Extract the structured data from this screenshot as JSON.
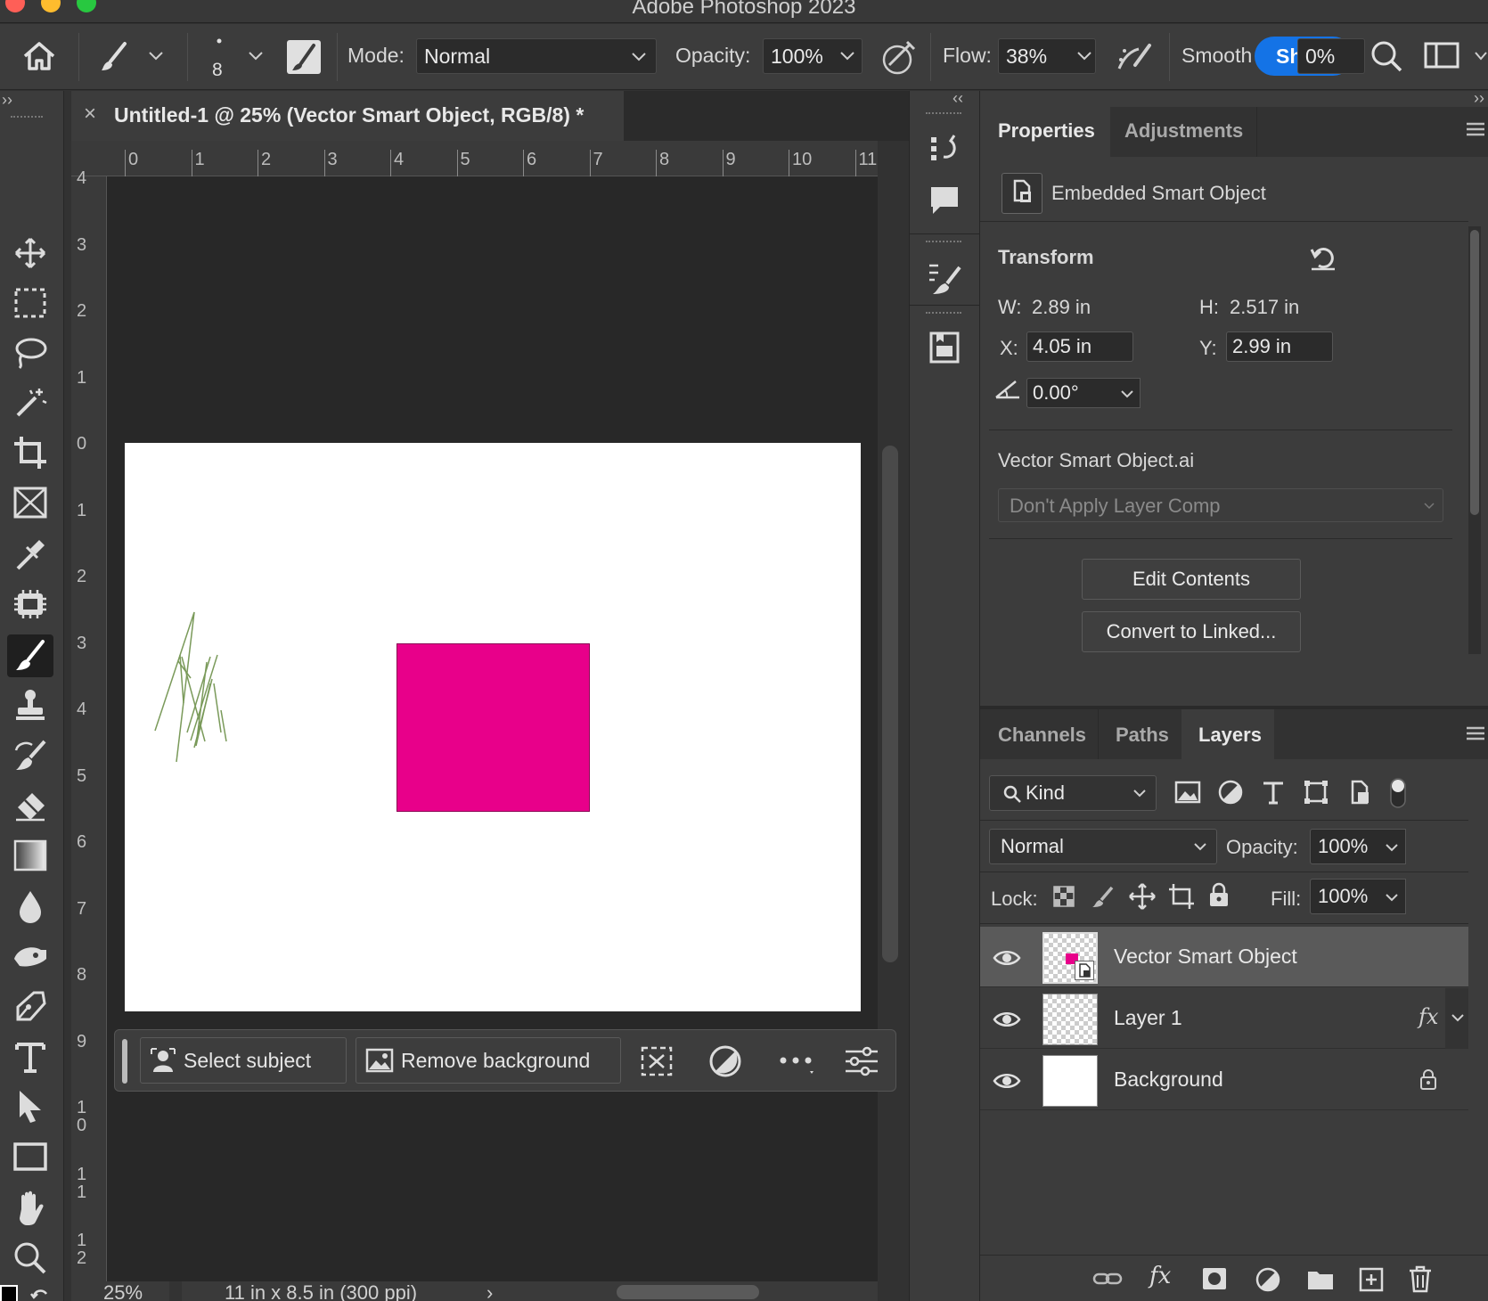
{
  "app": {
    "window_title": "Adobe Photoshop 2023"
  },
  "options_bar": {
    "brush_size": "8",
    "mode_label": "Mode:",
    "mode_value": "Normal",
    "opacity_label": "Opacity:",
    "opacity_value": "100%",
    "flow_label": "Flow:",
    "flow_value": "38%",
    "smoothing_label": "Smooth",
    "smoothing_value": "0%",
    "tooltip_fragment": "Sh"
  },
  "document": {
    "tab_title": "Untitled-1 @ 25% (Vector Smart Object, RGB/8) *",
    "zoom": "25%",
    "doc_info": "11 in x 8.5 in (300 ppi)",
    "ruler_top": [
      "0",
      "1",
      "2",
      "3",
      "4",
      "5",
      "6",
      "7",
      "8",
      "9",
      "10",
      "11"
    ],
    "ruler_left": [
      "4",
      "3",
      "2",
      "1",
      "0",
      "1",
      "2",
      "3",
      "4",
      "5",
      "6",
      "7",
      "8",
      "9",
      "10",
      "11",
      "12"
    ],
    "colors": {
      "shape_fill": "#e8008a",
      "stroke_green": "#7a9a5a"
    }
  },
  "context_bar": {
    "select_subject": "Select subject",
    "remove_background": "Remove background"
  },
  "properties": {
    "tabs": [
      "Properties",
      "Adjustments"
    ],
    "object_type": "Embedded Smart Object",
    "transform_heading": "Transform",
    "w_label": "W:",
    "w_value": "2.89 in",
    "h_label": "H:",
    "h_value": "2.517 in",
    "x_label": "X:",
    "x_value": "4.05 in",
    "y_label": "Y:",
    "y_value": "2.99 in",
    "angle_value": "0.00°",
    "source_file": "Vector Smart Object.ai",
    "layer_comp_placeholder": "Don't Apply Layer Comp",
    "edit_contents": "Edit Contents",
    "convert_linked": "Convert to Linked..."
  },
  "layers_panel": {
    "tabs": [
      "Channels",
      "Paths",
      "Layers"
    ],
    "filter_kind": "Kind",
    "blend_mode": "Normal",
    "opacity_label": "Opacity:",
    "opacity_value": "100%",
    "lock_label": "Lock:",
    "fill_label": "Fill:",
    "fill_value": "100%",
    "layers": [
      {
        "name": "Vector Smart Object",
        "selected": true
      },
      {
        "name": "Layer 1",
        "fx": "fx"
      },
      {
        "name": "Background",
        "locked": true
      }
    ]
  }
}
